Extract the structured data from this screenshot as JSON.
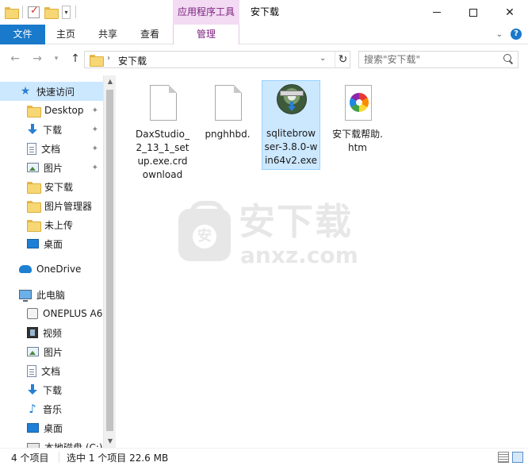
{
  "window": {
    "title": "安下载",
    "context_tab_header": "应用程序工具"
  },
  "ribbon": {
    "tabs": [
      "文件",
      "主页",
      "共享",
      "查看",
      "管理"
    ]
  },
  "address": {
    "path": "安下载",
    "search_placeholder": "搜索\"安下载\""
  },
  "nav_pane": {
    "items": [
      {
        "label": "快速访问",
        "icon": "star-icon",
        "selected": true
      },
      {
        "label": "Desktop",
        "icon": "folder-icon",
        "pinned": true
      },
      {
        "label": "下载",
        "icon": "download-icon",
        "pinned": true
      },
      {
        "label": "文档",
        "icon": "document-icon",
        "pinned": true
      },
      {
        "label": "图片",
        "icon": "picture-icon",
        "pinned": true
      },
      {
        "label": "安下载",
        "icon": "folder-icon"
      },
      {
        "label": "图片管理器",
        "icon": "folder-icon"
      },
      {
        "label": "未上传",
        "icon": "folder-icon"
      },
      {
        "label": "桌面",
        "icon": "desktop-icon"
      },
      {
        "label": "OneDrive",
        "icon": "cloud-icon"
      },
      {
        "label": "此电脑",
        "icon": "computer-icon"
      },
      {
        "label": "ONEPLUS A6",
        "icon": "phone-icon"
      },
      {
        "label": "视频",
        "icon": "video-icon"
      },
      {
        "label": "图片",
        "icon": "picture-icon"
      },
      {
        "label": "文档",
        "icon": "document-icon"
      },
      {
        "label": "下载",
        "icon": "download-icon"
      },
      {
        "label": "音乐",
        "icon": "music-icon"
      },
      {
        "label": "桌面",
        "icon": "desktop-icon"
      },
      {
        "label": "本地磁盘 (C:)",
        "icon": "drive-icon"
      }
    ]
  },
  "files": [
    {
      "name": "DaxStudio_2_13_1_setup.exe.crdownload",
      "icon": "blank-file-icon",
      "selected": false
    },
    {
      "name": "pnghhbd.",
      "icon": "blank-file-icon",
      "selected": false
    },
    {
      "name": "sqlitebrowser-3.8.0-win64v2.exe",
      "icon": "installer-icon",
      "selected": true
    },
    {
      "name": "安下载帮助.htm",
      "icon": "html-file-icon",
      "selected": false
    }
  ],
  "watermark": {
    "chinese": "安下载",
    "english": "anxz.com",
    "badge": "安"
  },
  "status": {
    "item_count": "4 个项目",
    "selected_info": "选中 1 个项目  22.6 MB"
  },
  "colors": {
    "file_tab_blue": "#1979ca",
    "context_tab_purple": "#f2dbf3",
    "selection": "#cce8ff"
  }
}
